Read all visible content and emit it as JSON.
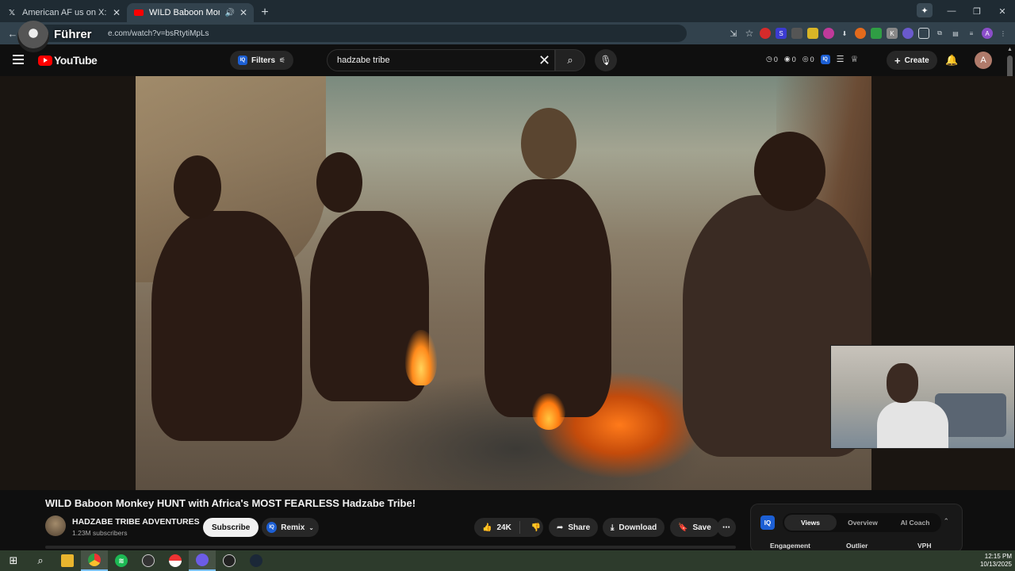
{
  "browser": {
    "tabs": [
      {
        "label": "American AF us on X: \"One of t",
        "favicon": "x-logo-icon",
        "active": false
      },
      {
        "label": "WILD Baboon Monkey HUN",
        "favicon": "youtube-favicon-icon",
        "active": true
      }
    ],
    "url": "e.com/watch?v=bsRtytiMpLs",
    "overlay_text": "Führer"
  },
  "youtube": {
    "logo_text": "YouTube",
    "filters_label": "Filters",
    "search_query": "hadzabe tribe",
    "stats": [
      "0",
      "0",
      "0"
    ],
    "create_label": "Create",
    "avatar_letter": "A"
  },
  "video": {
    "title": "WILD Baboon Monkey HUNT with Africa's MOST FEARLESS Hadzabe Tribe!",
    "channel_name": "HADZABE TRIBE ADVENTURES",
    "subscribers": "1.23M subscribers",
    "subscribe_label": "Subscribe",
    "remix_label": "Remix",
    "like_count": "24K",
    "share_label": "Share",
    "download_label": "Download",
    "save_label": "Save"
  },
  "iq_panel": {
    "logo": "IQ",
    "tabs": [
      "Views",
      "Overview",
      "AI Coach"
    ],
    "active_tab": "Views",
    "columns": [
      "Engagement",
      "Outlier",
      "VPH"
    ]
  },
  "taskbar": {
    "time": "12:15 PM",
    "date": "10/13/2025"
  },
  "colors": {
    "youtube_red": "#ff0000",
    "iq_blue": "#1c5fd4",
    "background": "#0f0f0f"
  }
}
